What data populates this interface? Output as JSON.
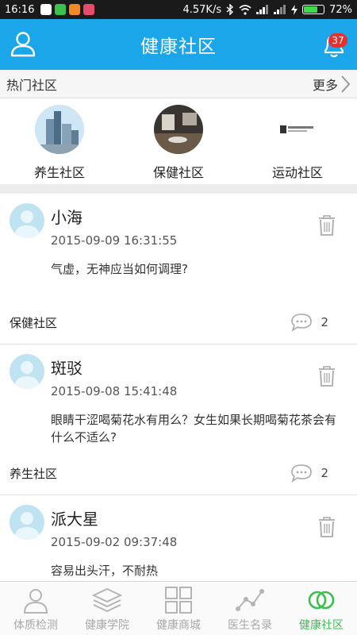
{
  "status_bar": {
    "time": "16:16",
    "net_speed": "4.57K/s",
    "battery": "72%",
    "battery_level": 0.72
  },
  "header": {
    "title": "健康社区",
    "notification_count": "37"
  },
  "hot": {
    "title": "热门社区",
    "more_label": "更多",
    "communities": [
      {
        "label": "养生社区"
      },
      {
        "label": "保健社区"
      },
      {
        "label": "运动社区"
      }
    ]
  },
  "posts": [
    {
      "name": "小海",
      "time": "2015-09-09 16:31:55",
      "body": "气虚，无神应当如何调理?",
      "community": "保健社区",
      "comments": "2"
    },
    {
      "name": "斑驳",
      "time": "2015-09-08 15:41:48",
      "body": "眼睛干涩喝菊花水有用么？女生如果长期喝菊花茶会有什么不适么?",
      "community": "养生社区",
      "comments": "2"
    },
    {
      "name": "派大星",
      "time": "2015-09-02 09:37:48",
      "body": "容易出头汗，不耐热\n稍微活动一下，头部大量出汗，颈部，胸前也",
      "community": "",
      "comments": ""
    }
  ],
  "nav": [
    {
      "label": "体质检测",
      "icon": "person-icon"
    },
    {
      "label": "健康学院",
      "icon": "layers-icon"
    },
    {
      "label": "健康商城",
      "icon": "grid-icon"
    },
    {
      "label": "医生名录",
      "icon": "chart-icon"
    },
    {
      "label": "健康社区",
      "icon": "rings-icon"
    }
  ],
  "colors": {
    "header": "#1aa6e8",
    "active_nav": "#3bbf4e",
    "badge": "#e83030"
  }
}
